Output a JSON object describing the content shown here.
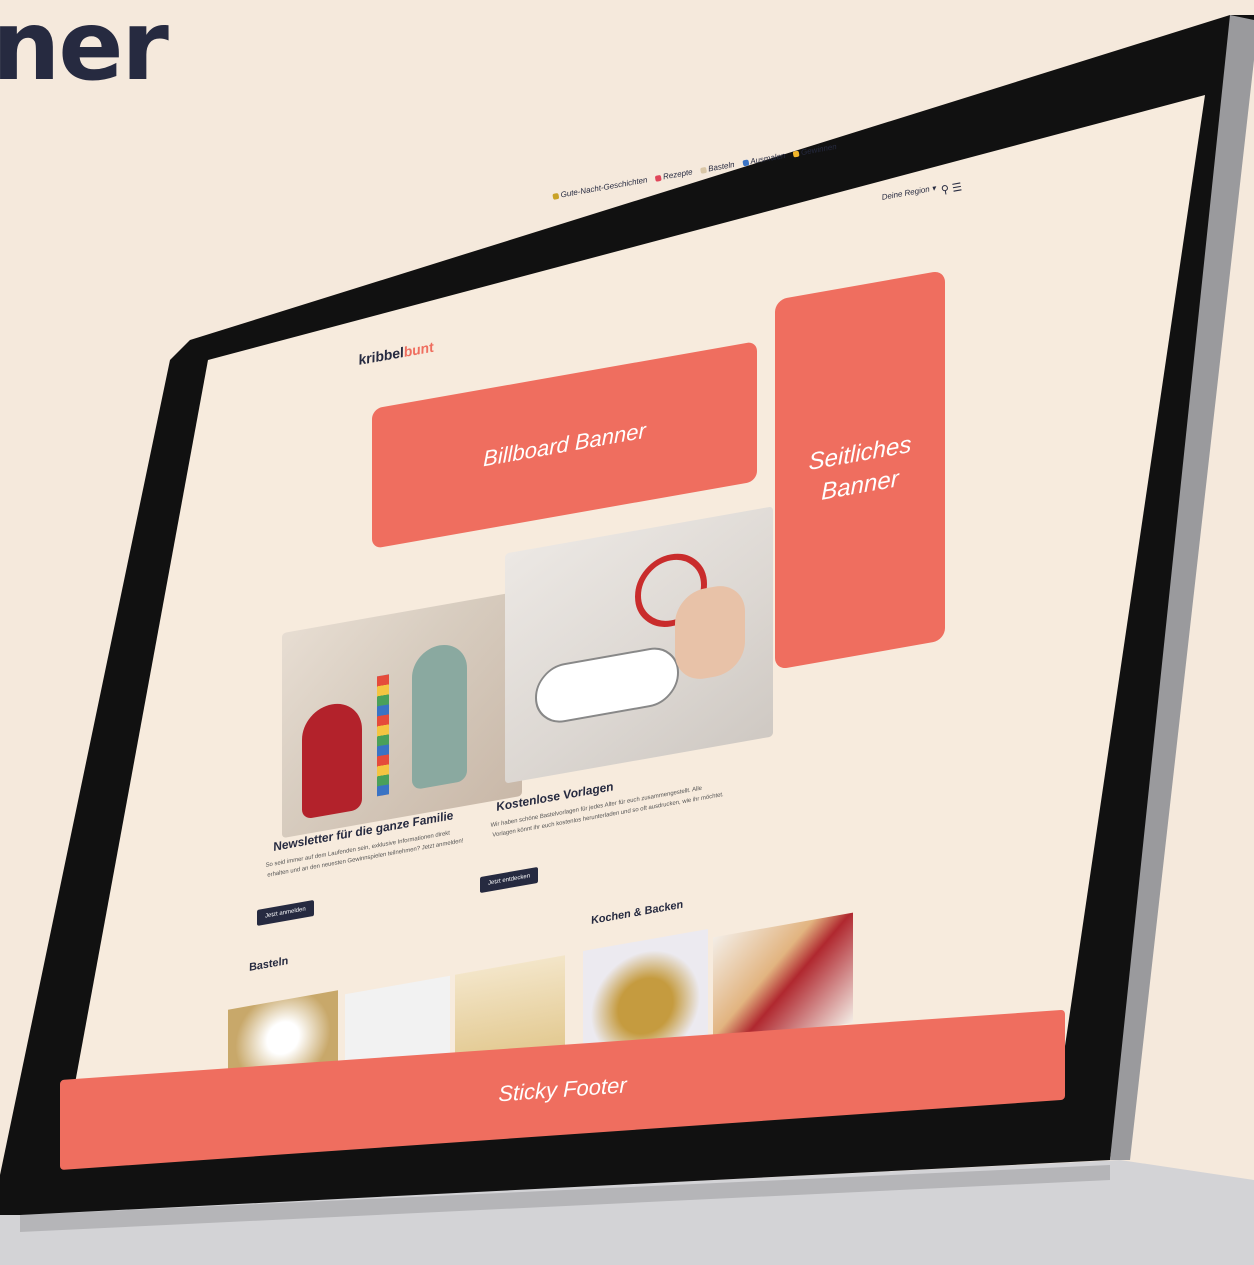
{
  "headline": "ner",
  "site": {
    "logo_main": "kribbel",
    "logo_accent": "bunt",
    "nav": [
      {
        "label": "Gute-Nacht-Geschichten",
        "color": "#c9a227"
      },
      {
        "label": "Rezepte",
        "color": "#e0465a"
      },
      {
        "label": "Basteln",
        "color": "#d9c6a6"
      },
      {
        "label": "Ausmalen",
        "color": "#3a73c4"
      },
      {
        "label": "Gewinnen",
        "color": "#f0b429"
      }
    ],
    "region": "Deine Region",
    "icons": "⚲ ☰"
  },
  "banners": {
    "billboard": "Billboard Banner",
    "side_line1": "Seitliches",
    "side_line2": "Banner",
    "footer": "Sticky Footer"
  },
  "cards": [
    {
      "title": "Newsletter für die ganze Familie",
      "text": "So seid immer auf dem Laufenden sein, exklusive Informationen direkt erhalten und an den neuesten Gewinnspielen teilnehmen? Jetzt anmelden!",
      "button": "Jetzt anmelden"
    },
    {
      "title": "Kostenlose Vorlagen",
      "text": "Wir haben schöne Bastelvorlagen für jedes Alter für euch zusammengestellt. Alle Vorlagen könnt ihr euch kostenlos herunterladen und so oft ausdrucken, wie ihr möchtet.",
      "button": "Jetzt entdecken"
    }
  ],
  "sections": {
    "basteln": "Basteln",
    "kochen": "Kochen & Backen"
  },
  "colors": {
    "accent": "#ef6e5f",
    "dark": "#262a40",
    "background": "#f5e9dc"
  }
}
